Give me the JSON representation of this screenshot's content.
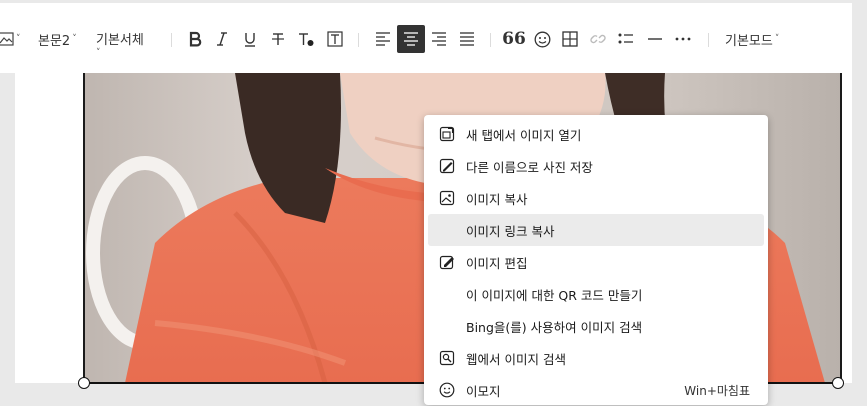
{
  "toolbar": {
    "paragraph_style": "본문2",
    "font_family": "기본서체",
    "mode": "기본모드"
  },
  "context_menu": {
    "items": [
      {
        "label": "새 탭에서 이미지 열기",
        "icon": "open-new-tab-icon"
      },
      {
        "label": "다른 이름으로 사진 저장",
        "icon": "save-image-icon"
      },
      {
        "label": "이미지 복사",
        "icon": "copy-image-icon"
      },
      {
        "label": "이미지 링크 복사",
        "icon": "",
        "highlighted": true
      },
      {
        "label": "이미지 편집",
        "icon": "edit-image-icon"
      },
      {
        "label": "이 이미지에 대한 QR 코드 만들기",
        "icon": ""
      },
      {
        "label": "Bing을(를) 사용하여 이미지 검색",
        "icon": ""
      },
      {
        "label": "웹에서 이미지 검색",
        "icon": "web-image-search-icon"
      },
      {
        "label": "이모지",
        "icon": "emoji-icon",
        "shortcut": "Win+마침표"
      }
    ]
  }
}
